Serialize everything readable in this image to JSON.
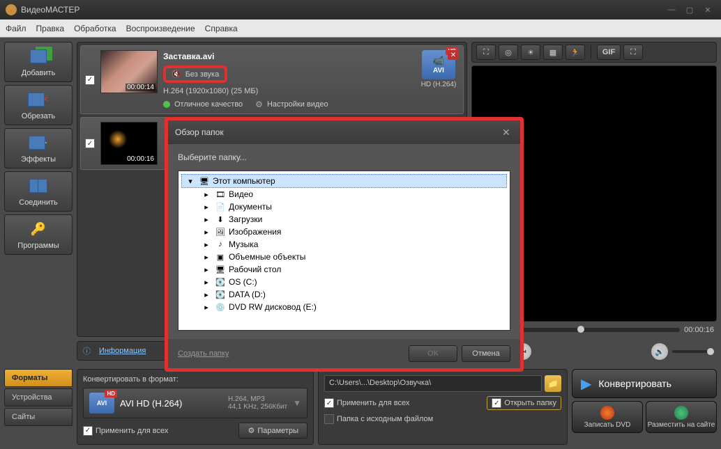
{
  "app": {
    "title": "ВидеоМАСТЕР"
  },
  "menu": {
    "file": "Файл",
    "edit": "Правка",
    "process": "Обработка",
    "playback": "Воспроизведение",
    "help": "Справка"
  },
  "tools": {
    "add": "Добавить",
    "cut": "Обрезать",
    "effects": "Эффекты",
    "join": "Соединить",
    "programs": "Программы"
  },
  "videos": [
    {
      "title": "Заставка.avi",
      "audio": "Без звука",
      "codec": "H.264 (1920x1080) (25 МБ)",
      "quality": "Отличное качество",
      "settings": "Настройки видео",
      "time": "00:00:14",
      "format": "AVI",
      "format_label": "HD (H.264)"
    },
    {
      "title": "",
      "time": "00:00:16"
    }
  ],
  "info_bar": {
    "info": "Информация",
    "quality": ""
  },
  "preview": {
    "time": "00:00:16"
  },
  "gif_label": "GIF",
  "bottom": {
    "convert_label": "Конвертировать в формат:",
    "tabs": {
      "formats": "Форматы",
      "devices": "Устройства",
      "sites": "Сайты"
    },
    "format": {
      "name": "AVI HD (H.264)",
      "detail": "H.264, MP3\n44,1 KHz, 256Кбит",
      "badge": "AVI"
    },
    "apply_all": "Применить для всех",
    "params": "Параметры",
    "output": {
      "path": "C:\\Users\\...\\Desktop\\Озвучка\\",
      "apply_all": "Применить для всех",
      "source_folder": "Папка с исходным файлом",
      "open_folder": "Открыть папку"
    },
    "convert": "Конвертировать",
    "burn": "Записать DVD",
    "publish": "Разместить на сайте"
  },
  "dialog": {
    "title": "Обзор папок",
    "prompt": "Выберите папку...",
    "items": [
      {
        "label": "Этот компьютер",
        "icon": "🖥",
        "selected": true,
        "level": 0
      },
      {
        "label": "Видео",
        "icon": "🎞",
        "level": 1
      },
      {
        "label": "Документы",
        "icon": "📄",
        "level": 1
      },
      {
        "label": "Загрузки",
        "icon": "⬇",
        "level": 1
      },
      {
        "label": "Изображения",
        "icon": "🖼",
        "level": 1
      },
      {
        "label": "Музыка",
        "icon": "♪",
        "level": 1
      },
      {
        "label": "Объемные объекты",
        "icon": "▣",
        "level": 1
      },
      {
        "label": "Рабочий стол",
        "icon": "🖥",
        "level": 1
      },
      {
        "label": "OS (C:)",
        "icon": "💽",
        "level": 1
      },
      {
        "label": "DATA (D:)",
        "icon": "💽",
        "level": 1
      },
      {
        "label": "DVD RW дисковод (E:)",
        "icon": "💿",
        "level": 1
      }
    ],
    "create": "Создать папку",
    "ok": "OK",
    "cancel": "Отмена"
  }
}
